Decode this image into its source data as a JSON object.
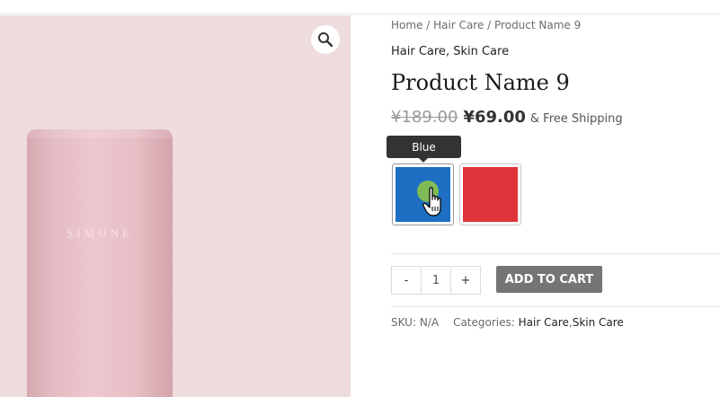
{
  "breadcrumb": {
    "home": "Home",
    "sep1": " / ",
    "category": "Hair Care",
    "sep2": " / ",
    "current": "Product Name 9"
  },
  "product": {
    "categories_top": [
      "Hair Care",
      "Skin Care"
    ],
    "title": "Product Name 9",
    "brand_mark": "SIMONE",
    "old_price": "¥189.00",
    "price": "¥69.00",
    "shipping": "& Free Shipping"
  },
  "variations": {
    "tooltip": "Blue",
    "swatches": [
      {
        "name": "Blue",
        "color": "#1e6fc4",
        "selected": true
      },
      {
        "name": "Red",
        "color": "#e0333a",
        "selected": false
      }
    ]
  },
  "cart": {
    "minus": "-",
    "quantity": "1",
    "plus": "+",
    "add_to_cart": "ADD TO CART"
  },
  "meta": {
    "sku_label": "SKU:",
    "sku_value": "N/A",
    "categories_label": "Categories:",
    "categories": [
      "Hair Care",
      "Skin Care"
    ]
  },
  "colors": {
    "gallery_bg": "#efdcdc",
    "button_gray": "#757575",
    "tooltip_bg": "#333333"
  },
  "icons": {
    "zoom": "search-icon",
    "cursor": "hand-pointer-icon"
  }
}
